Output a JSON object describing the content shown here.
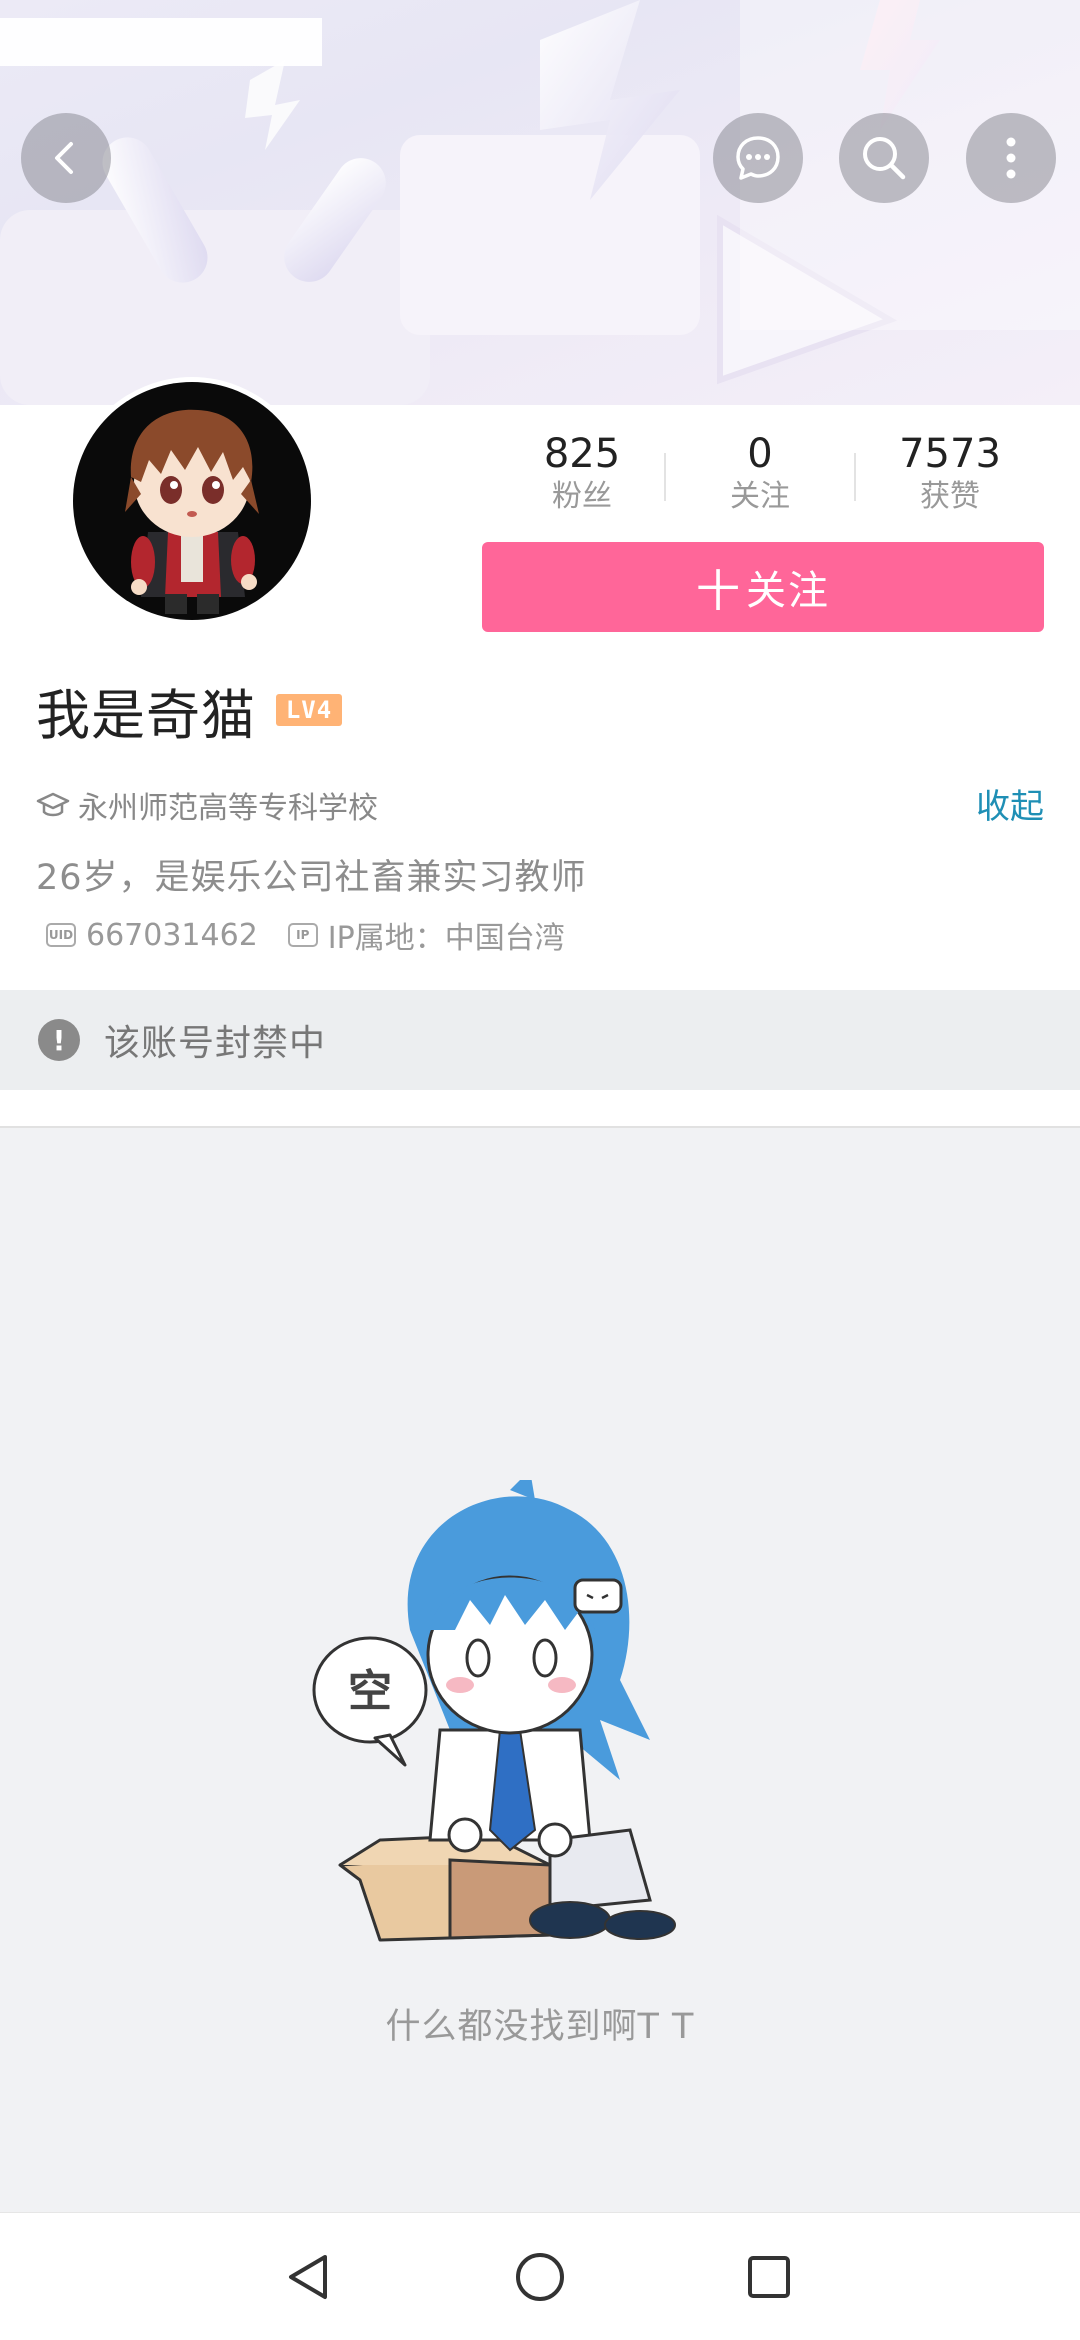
{
  "header": {
    "back_icon": "chevron-left-icon",
    "message_icon": "chat-bubble-icon",
    "search_icon": "search-icon",
    "more_icon": "vertical-dots-icon"
  },
  "stats": [
    {
      "value": "825",
      "label": "粉丝"
    },
    {
      "value": "0",
      "label": "关注"
    },
    {
      "value": "7573",
      "label": "获赞"
    }
  ],
  "follow_button": {
    "plus": "十",
    "label": "关注"
  },
  "profile": {
    "name": "我是奇猫",
    "level_badge": "LV4",
    "school": "永州师范高等专科学校",
    "collapse_label": "收起",
    "bio": "26岁，是娱乐公司社畜兼实习教师",
    "uid_tag": "UID",
    "uid": "667031462",
    "ip_tag": "IP",
    "ip_location": "IP属地：中国台湾"
  },
  "notice": {
    "icon": "exclamation-icon",
    "text": "该账号封禁中"
  },
  "empty_state": {
    "bubble_text": "空",
    "message": "什么都没找到啊T T"
  },
  "colors": {
    "accent_pink": "#ff6699",
    "link_blue": "#1f8fb5",
    "level_orange": "#ffb375"
  }
}
